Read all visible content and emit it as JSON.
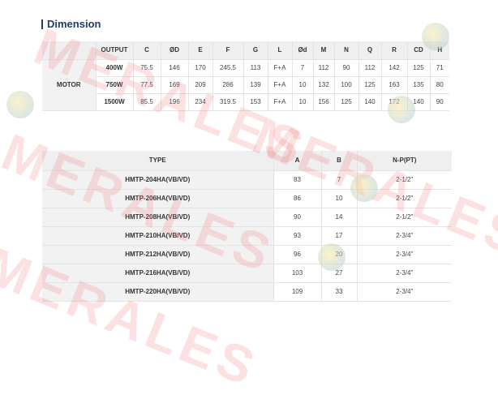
{
  "section": {
    "title": "Dimension"
  },
  "dimension_table": {
    "headers": [
      "",
      "OUTPUT",
      "C",
      "ØD",
      "E",
      "F",
      "G",
      "L",
      "Ød",
      "M",
      "N",
      "Q",
      "R",
      "CD",
      "H"
    ],
    "group_label": "MOTOR",
    "rows": [
      [
        "400W",
        "75.5",
        "146",
        "170",
        "245.5",
        "113",
        "F+A",
        "7",
        "112",
        "90",
        "112",
        "142",
        "125",
        "71"
      ],
      [
        "750W",
        "77.5",
        "169",
        "209",
        "286",
        "139",
        "F+A",
        "10",
        "132",
        "100",
        "125",
        "163",
        "135",
        "80"
      ],
      [
        "1500W",
        "85.5",
        "196",
        "234",
        "319.5",
        "153",
        "F+A",
        "10",
        "156",
        "125",
        "140",
        "172",
        "140",
        "90"
      ]
    ]
  },
  "type_table": {
    "headers": [
      "TYPE",
      "A",
      "B",
      "N-P(PT)"
    ],
    "rows": [
      [
        "HMTP-204HA(VB/VD)",
        "83",
        "7",
        "2-1/2\""
      ],
      [
        "HMTP-206HA(VB/VD)",
        "86",
        "10",
        "2-1/2\""
      ],
      [
        "HMTP-208HA(VB/VD)",
        "90",
        "14",
        "2-1/2\""
      ],
      [
        "HMTP-210HA(VB/VD)",
        "93",
        "17",
        "2-3/4\""
      ],
      [
        "HMTP-212HA(VB/VD)",
        "96",
        "20",
        "2-3/4\""
      ],
      [
        "HMTP-216HA(VB/VD)",
        "103",
        "27",
        "2-3/4\""
      ],
      [
        "HMTP-220HA(VB/VD)",
        "109",
        "33",
        "2-3/4\""
      ]
    ]
  },
  "watermark": {
    "text": "MERALES"
  }
}
